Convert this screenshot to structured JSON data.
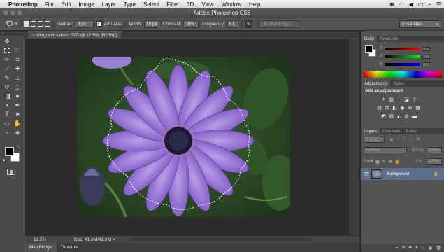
{
  "menubar": {
    "app_name": "Photoshop",
    "items": [
      "File",
      "Edit",
      "Image",
      "Layer",
      "Type",
      "Select",
      "Filter",
      "3D",
      "View",
      "Window",
      "Help"
    ]
  },
  "window": {
    "title": "Adobe Photoshop CS6"
  },
  "options_bar": {
    "feather_label": "Feather:",
    "feather_value": "0 px",
    "anti_alias_label": "Anti-alias",
    "width_label": "Width:",
    "width_value": "10 px",
    "contrast_label": "Contrast:",
    "contrast_value": "10%",
    "frequency_label": "Frequency:",
    "frequency_value": "57",
    "refine_edge_label": "Refine Edge...",
    "workspace_label": "Essentials"
  },
  "document": {
    "tab_title": "Magnetic-Lasso.JPG @ 12.5% (RGB/8)",
    "close_glyph": "×"
  },
  "status": {
    "zoom": "12.5%",
    "doc_info": "Doc: 41.8M/41.8M"
  },
  "bottom_tabs": [
    "Mini Bridge",
    "Timeline"
  ],
  "color_panel": {
    "tabs": [
      "Color",
      "Swatches"
    ],
    "channels": [
      "R",
      "G",
      "B"
    ],
    "colors": {
      "foreground": "#000000",
      "background": "#ffffff"
    }
  },
  "adjustments_panel": {
    "tabs": [
      "Adjustments",
      "Styles"
    ],
    "heading": "Add an adjustment"
  },
  "layers_panel": {
    "tabs": [
      "Layers",
      "Channels",
      "Paths"
    ],
    "filter_label": "Kind",
    "blend_mode": "Normal",
    "opacity_label": "Opacity:",
    "opacity_value": "100%",
    "lock_label": "Lock:",
    "fill_label": "Fill:",
    "fill_value": "100%",
    "layer_name": "Background"
  },
  "icons": {
    "tools": [
      "move-icon",
      "marquee-icon",
      "lasso-icon",
      "quick-select-icon",
      "crop-icon",
      "eyedropper-icon",
      "healing-icon",
      "brush-icon",
      "stamp-icon",
      "history-brush-icon",
      "eraser-icon",
      "gradient-icon",
      "blur-icon",
      "dodge-icon",
      "pen-icon",
      "type-icon",
      "path-select-icon",
      "shape-icon",
      "hand-icon",
      "zoom-icon"
    ]
  }
}
